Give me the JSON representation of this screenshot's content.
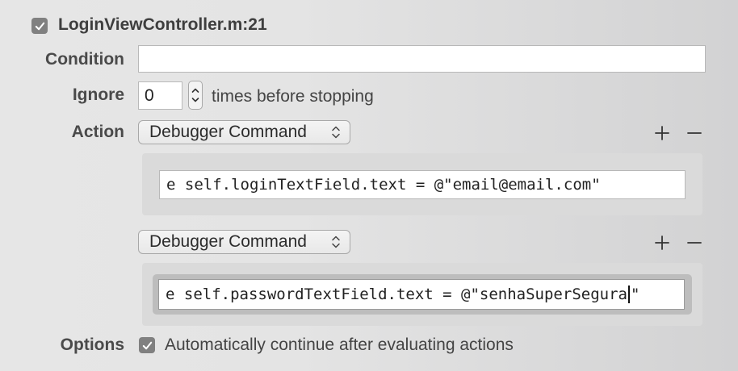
{
  "breakpoint": {
    "enabled": true,
    "title": "LoginViewController.m:21"
  },
  "condition": {
    "label": "Condition",
    "value": ""
  },
  "ignore": {
    "label": "Ignore",
    "count": "0",
    "suffix": "times before stopping"
  },
  "action": {
    "label": "Action",
    "items": [
      {
        "type": "Debugger Command",
        "command": "e self.loginTextField.text = @\"email@email.com\""
      },
      {
        "type": "Debugger Command",
        "command_before_caret": "e self.passwordTextField.text = @\"senhaSuperSegura",
        "command_after_caret": "\""
      }
    ]
  },
  "options": {
    "label": "Options",
    "auto_continue_checked": true,
    "auto_continue_label": "Automatically continue after evaluating actions"
  },
  "colors": {
    "checkbox": "#808080",
    "background_left": "#e6e6e6",
    "background_right": "#d2d2d3"
  }
}
